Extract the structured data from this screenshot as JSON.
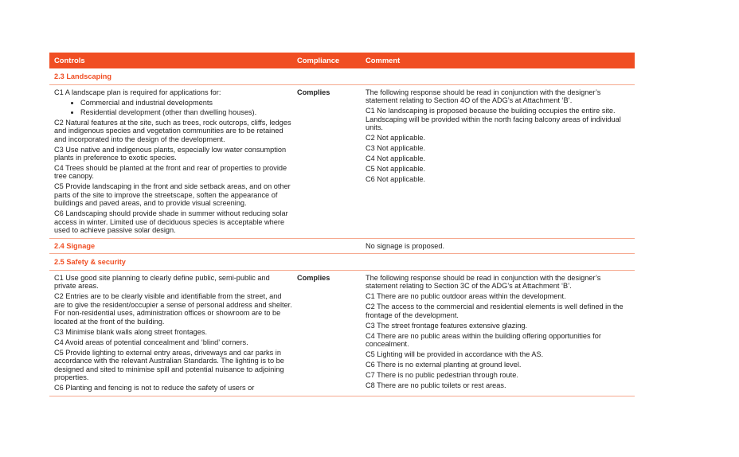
{
  "header": {
    "controls": "Controls",
    "compliance": "Compliance",
    "comment": "Comment"
  },
  "landscaping": {
    "title": "2.3 Landscaping",
    "controls": {
      "c1": "C1 A landscape plan is required for applications for:",
      "bullets": [
        "Commercial and industrial developments",
        "Residential development (other than dwelling houses)."
      ],
      "c2": "C2 Natural features at the site, such as trees, rock outcrops, cliffs, ledges and indigenous species and vegetation communities are to be retained and incorporated into the design of the development.",
      "c3": "C3 Use native and indigenous plants, especially low water consumption plants in preference to exotic species.",
      "c4": "C4 Trees should be planted at the front and rear of properties to provide tree canopy.",
      "c5": "C5 Provide landscaping in the front and side setback areas, and on other parts of the site to improve the streetscape, soften the appearance of buildings and paved areas, and to provide visual screening.",
      "c6": "C6 Landscaping should provide shade in summer without reducing solar access in winter. Limited use of deciduous species is acceptable where used to achieve passive solar design."
    },
    "compliance": "Complies",
    "comments": [
      "The following response should be read in conjunction with the designer’s statement relating to Section 4O of the ADG’s at Attachment ‘B’.",
      "C1 No landscaping is proposed because the building occupies the entire site.  Landscaping will be provided within the north facing balcony areas of individual units.",
      "C2 Not applicable.",
      "C3 Not applicable.",
      "C4 Not applicable.",
      "C5 Not applicable.",
      "C6 Not applicable."
    ]
  },
  "signage": {
    "title": "2.4 Signage",
    "comment": "No signage is proposed."
  },
  "safety": {
    "title": "2.5 Safety & security",
    "controls": [
      "C1 Use good site planning to clearly define public, semi-public and private areas.",
      "C2 Entries are to be clearly visible and identifiable from the street, and are to give the resident/occupier a sense of personal address and shelter. For non-residential uses, administration offices or showroom are to be located at the front of the building.",
      "C3 Minimise blank walls along street frontages.",
      "C4 Avoid areas of potential concealment and ‘blind’ corners.",
      "C5 Provide lighting to external entry areas, driveways and car parks in accordance with the relevant Australian Standards. The lighting is to be designed and sited to minimise spill and potential nuisance to adjoining properties.",
      "C6 Planting and fencing is not to reduce the safety of users or"
    ],
    "compliance": "Complies",
    "comments": [
      "The following response should be read in conjunction with the designer’s statement relating to Section 3C of the ADG’s at Attachment ‘B’.",
      "C1 There are no public outdoor areas within the development.",
      "C2 The access to the commercial and residential elements is well defined in the frontage of the development.",
      "C3 The street frontage features extensive glazing.",
      "C4 There are no public areas within the building offering opportunities for concealment.",
      "C5 Lighting will be provided in accordance with the AS.",
      "C6 There is no external planting at ground level.",
      "C7 There is no public pedestrian through route.",
      "C8 There are no public toilets or rest areas."
    ]
  }
}
